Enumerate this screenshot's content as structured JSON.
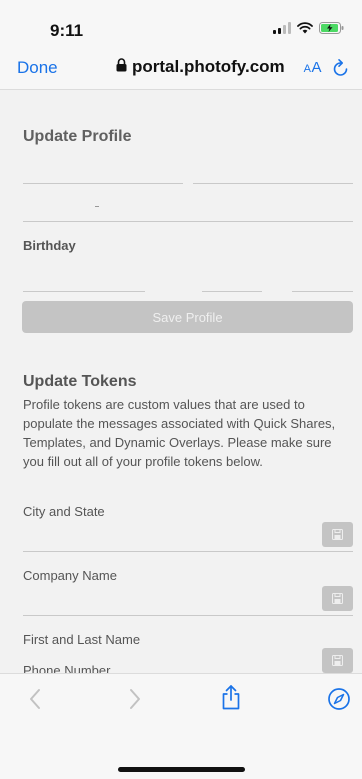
{
  "status": {
    "time": "9:11",
    "icons": [
      "signal-icon",
      "wifi-icon",
      "battery-charging-icon"
    ]
  },
  "browser": {
    "done_label": "Done",
    "url": "portal.photofy.com",
    "text_size_big": "A",
    "text_size_small": "A",
    "icons": [
      "lock-icon",
      "reload-icon",
      "back-icon",
      "forward-icon",
      "share-icon",
      "compass-icon"
    ]
  },
  "profile": {
    "title": "Update Profile",
    "birthday_label": "Birthday",
    "save_label": "Save Profile"
  },
  "tokens": {
    "title": "Update Tokens",
    "description": "Profile tokens are custom values that are used to populate the messages associated with Quick Shares, Templates, and Dynamic Overlays. Please make sure you fill out all of your profile tokens below.",
    "fields": [
      {
        "label": "City and State"
      },
      {
        "label": "Company Name"
      },
      {
        "label": "First and Last Name"
      },
      {
        "label": "Phone Number"
      }
    ]
  },
  "colors": {
    "accent": "#1a73e8",
    "button_disabled": "#c4c4c4",
    "page_bg": "#f2f2f2"
  }
}
